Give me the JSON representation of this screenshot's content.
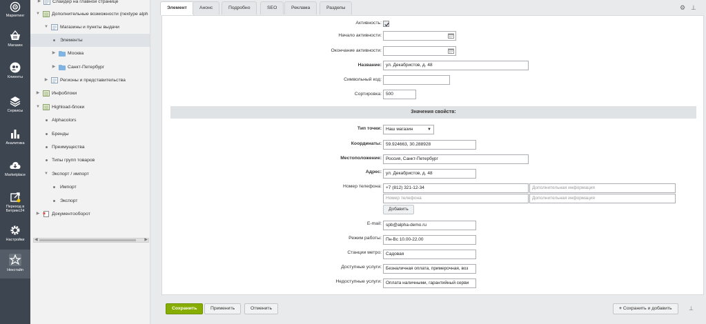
{
  "rail": [
    {
      "label": "Маркетинг",
      "icon": "target-icon"
    },
    {
      "label": "Магазин",
      "icon": "basket-icon"
    },
    {
      "label": "Клиенты",
      "icon": "clients-icon"
    },
    {
      "label": "Сервисы",
      "icon": "layers-icon"
    },
    {
      "label": "Аналитика",
      "icon": "bar-chart-icon"
    },
    {
      "label": "Marketplace",
      "icon": "cloud-download-icon"
    },
    {
      "label": "Переход в Битрикс24",
      "icon": "bitrix24-icon"
    },
    {
      "label": "Настройки",
      "icon": "gear-icon"
    },
    {
      "label": "Некстайп",
      "icon": "nextype-icon"
    }
  ],
  "tree": [
    {
      "label": "Слайдер на главной странице"
    },
    {
      "label": "Дополнительные возможности (nextype alph"
    },
    {
      "label": "Магазины и пункты выдачи"
    },
    {
      "label": "Элементы"
    },
    {
      "label": "Москва"
    },
    {
      "label": "Санкт-Петербург"
    },
    {
      "label": "Регионы и представительства"
    },
    {
      "label": "Инфоблоки"
    },
    {
      "label": "Highload-блоки"
    },
    {
      "label": "Alphacolors"
    },
    {
      "label": "Бренды"
    },
    {
      "label": "Преимущества"
    },
    {
      "label": "Типы групп товаров"
    },
    {
      "label": "Экспорт / импорт"
    },
    {
      "label": "Импорт"
    },
    {
      "label": "Экспорт"
    },
    {
      "label": "Документооборот"
    }
  ],
  "tabs": [
    {
      "label": "Элемент"
    },
    {
      "label": "Анонс"
    },
    {
      "label": "Подробно"
    },
    {
      "label": "SEO"
    },
    {
      "label": "Реклама"
    },
    {
      "label": "Разделы"
    }
  ],
  "form": {
    "active_label": "Активность:",
    "active_checked": true,
    "start_label": "Начало активности:",
    "start_value": "",
    "end_label": "Окончание активности:",
    "end_value": "",
    "name_label": "Название:",
    "name_value": "ул. Декабристов, д. 48",
    "code_label": "Символьный код:",
    "code_value": "",
    "sort_label": "Сортировка:",
    "sort_value": "500",
    "section_title": "Значения свойств:",
    "point_type_label": "Тип точки:",
    "point_type_value": "Наш магазин",
    "coords_label": "Координаты:",
    "coords_value": "59.924663, 30.288928",
    "location_label": "Местоположение:",
    "location_value": "Россия, Санкт-Петербург",
    "address_label": "Адрес:",
    "address_value": "ул. Декабристов, д. 48",
    "phone_label": "Номер телефона:",
    "phone1_value": "+7 (812) 321-12-34",
    "phone1_info_placeholder": "Дополнительная информация",
    "phone2_placeholder": "Номер телефона",
    "phone2_info_placeholder": "Дополнительная информация",
    "add_button": "Добавить",
    "email_label": "E-mail:",
    "email_value": "spb@alpha-demo.ru",
    "hours_label": "Режим работы:",
    "hours_value": "Пн-Вс 10.00-22.00",
    "metro_label": "Станции метро:",
    "metro_value": "Садовая",
    "services_label": "Доступные услуги:",
    "services_value": "Безналичная оплата, примерочная, воз",
    "unavailable_label": "Недоступные услуги:",
    "unavailable_value": "Оплата наличными, гарантийный серви"
  },
  "footer": {
    "save": "Сохранить",
    "apply": "Применить",
    "cancel": "Отменить",
    "save_add": "Сохранить и добавить"
  },
  "colors": {
    "rail_bg": "#3d4550",
    "save_btn": "#86ad00",
    "folder": "#7fb5e6"
  }
}
